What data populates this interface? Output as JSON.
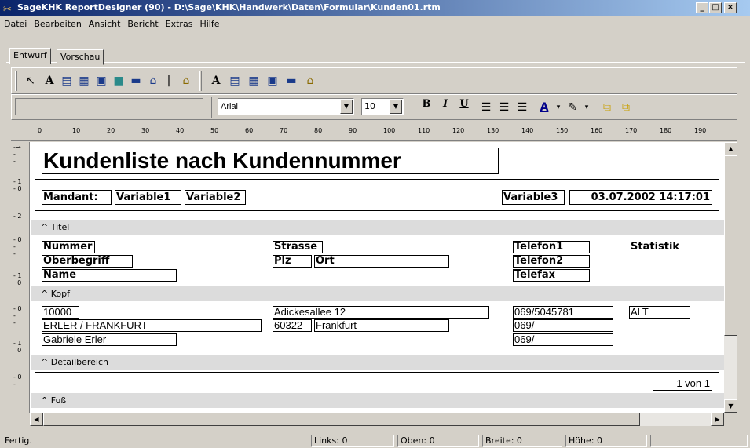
{
  "window": {
    "title": "SageKHK ReportDesigner (90) - D:\\Sage\\KHK\\Handwerk\\Daten\\Formular\\Kunden01.rtm",
    "minimize": "_",
    "maximize": "□",
    "close": "×"
  },
  "menu": [
    "Datei",
    "Bearbeiten",
    "Ansicht",
    "Bericht",
    "Extras",
    "Hilfe"
  ],
  "tabs": {
    "design": "Entwurf",
    "preview": "Vorschau"
  },
  "format": {
    "font": "Arial",
    "size": "10",
    "bold": "B",
    "italic": "I",
    "underline": "U"
  },
  "ruler": [
    "0",
    "10",
    "20",
    "30",
    "40",
    "50",
    "60",
    "70",
    "80",
    "90",
    "100",
    "110",
    "120",
    "130",
    "140",
    "150",
    "160",
    "170",
    "180",
    "190"
  ],
  "report": {
    "title": "Kundenliste nach Kundennummer",
    "mandant_label": "Mandant:",
    "var1": "Variable1",
    "var2": "Variable2",
    "var3": "Variable3",
    "datetime": "03.07.2002 14:17:01",
    "bands": {
      "title": "Titel",
      "header": "Kopf",
      "detail": "Detailbereich",
      "footer": "Fuß"
    },
    "header_fields": {
      "nummer": "Nummer",
      "oberbegriff": "Oberbegriff",
      "name": "Name",
      "strasse": "Strasse",
      "plz": "Plz",
      "ort": "Ort",
      "telefon1": "Telefon1",
      "telefon2": "Telefon2",
      "telefax": "Telefax",
      "statistik": "Statistik"
    },
    "detail": {
      "nummer": "10000",
      "oberbegriff": "ERLER / FRANKFURT",
      "name": "Gabriele Erler",
      "strasse": "Adickesallee 12",
      "plz": "60322",
      "ort": "Frankfurt",
      "telefon1": "069/5045781",
      "telefon2": "069/",
      "telefax": "069/",
      "statistik": "ALT"
    },
    "page": "1 von 1"
  },
  "status": {
    "ready": "Fertig.",
    "links": "Links: 0",
    "oben": "Oben: 0",
    "breite": "Breite: 0",
    "hoehe": "Höhe: 0"
  }
}
